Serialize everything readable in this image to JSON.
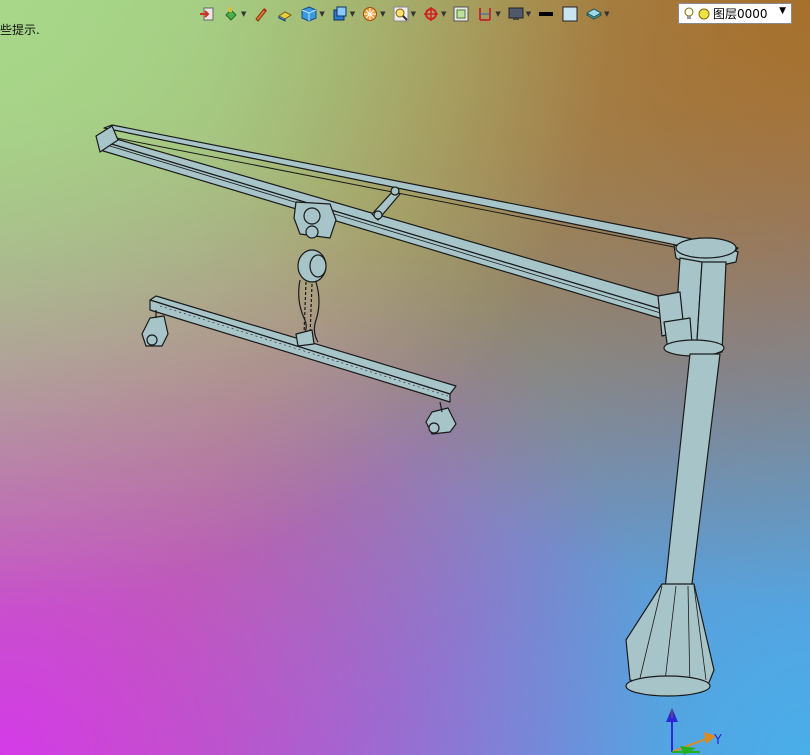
{
  "status": {
    "hint_text": "些提示."
  },
  "toolbar": {
    "buttons": [
      {
        "name": "import-icon"
      },
      {
        "name": "paint-bucket-icon",
        "dropdown": true
      },
      {
        "name": "pencil-icon"
      },
      {
        "name": "sketch-block-icon"
      },
      {
        "name": "cube-icon",
        "dropdown": true
      },
      {
        "name": "view-cube-icon",
        "dropdown": true
      },
      {
        "name": "render-wheel-icon",
        "dropdown": true
      },
      {
        "name": "zoom-fit-icon",
        "dropdown": true
      },
      {
        "name": "snap-target-icon",
        "dropdown": true
      },
      {
        "name": "grid-icon"
      },
      {
        "name": "work-plane-icon",
        "dropdown": true
      },
      {
        "name": "display-mode-icon",
        "dropdown": true
      },
      {
        "name": "line-weight-icon"
      },
      {
        "name": "fill-color-icon"
      },
      {
        "name": "layer-stack-icon",
        "dropdown": true
      }
    ],
    "layer": {
      "value": "图层0000"
    }
  },
  "axes": {
    "y_label": "Y"
  },
  "colors": {
    "part_fill": "#a7c4c8",
    "part_edge": "#1a1a1a",
    "axis_z": "#2a2ad8",
    "axis_y": "#e08a1e",
    "axis_x": "#22b022"
  }
}
